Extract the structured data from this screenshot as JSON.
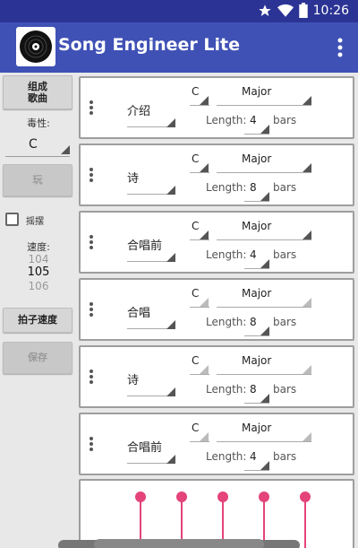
{
  "status_bar": {
    "time": "10:26"
  },
  "app_bar": {
    "title": "Song Engineer Lite",
    "logo_icon": "vinyl-record-icon",
    "overflow_icon": "more-vert-icon"
  },
  "left_panel": {
    "compose_label_line1": "组成",
    "compose_label_line2": "歌曲",
    "key_label": "毒性:",
    "key_value": "C",
    "play_label": "玩",
    "swing_label": "摇摆",
    "tempo_label": "速度:",
    "tempo_values": [
      "104",
      "105",
      "106"
    ],
    "tap_tempo_label": "拍子速度",
    "save_label": "保存"
  },
  "sections": [
    {
      "name": "介绍",
      "key": "C",
      "mode": "Major",
      "length_label": "Length:",
      "length": "4",
      "bars": "bars"
    },
    {
      "name": "诗",
      "key": "C",
      "mode": "Major",
      "length_label": "Length:",
      "length": "8",
      "bars": "bars"
    },
    {
      "name": "合唱前",
      "key": "C",
      "mode": "Major",
      "length_label": "Length:",
      "length": "4",
      "bars": "bars"
    },
    {
      "name": "合唱",
      "key": "C",
      "mode": "Major",
      "length_label": "Length:",
      "length": "8",
      "bars": "bars"
    },
    {
      "name": "诗",
      "key": "C",
      "mode": "Major",
      "length_label": "Length:",
      "length": "8",
      "bars": "bars"
    },
    {
      "name": "合唱前",
      "key": "C",
      "mode": "Major",
      "length_label": "Length:",
      "length": "4",
      "bars": "bars"
    }
  ],
  "colors": {
    "primary": "#3f51b5",
    "primary_dark": "#2b3494",
    "accent": "#e4447a"
  }
}
